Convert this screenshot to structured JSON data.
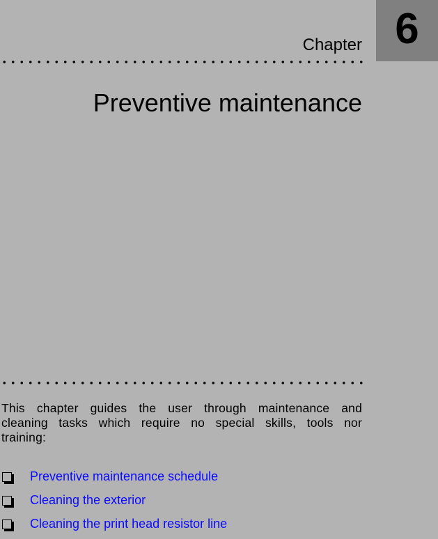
{
  "header": {
    "chapter_word": "Chapter",
    "chapter_number": "6"
  },
  "title": "Preventive maintenance",
  "intro": "This chapter guides the user through maintenance and cleaning tasks which require no special skills, tools nor training:",
  "topics": [
    {
      "label": "Preventive maintenance schedule",
      "icon": "checkbox-icon"
    },
    {
      "label": "Cleaning the exterior",
      "icon": "checkbox-icon"
    },
    {
      "label": "Cleaning the print head resistor line",
      "icon": "checkbox-icon"
    }
  ],
  "colors": {
    "background": "#b3b3b3",
    "chapter_box": "#808080",
    "link": "#0a0aff"
  }
}
